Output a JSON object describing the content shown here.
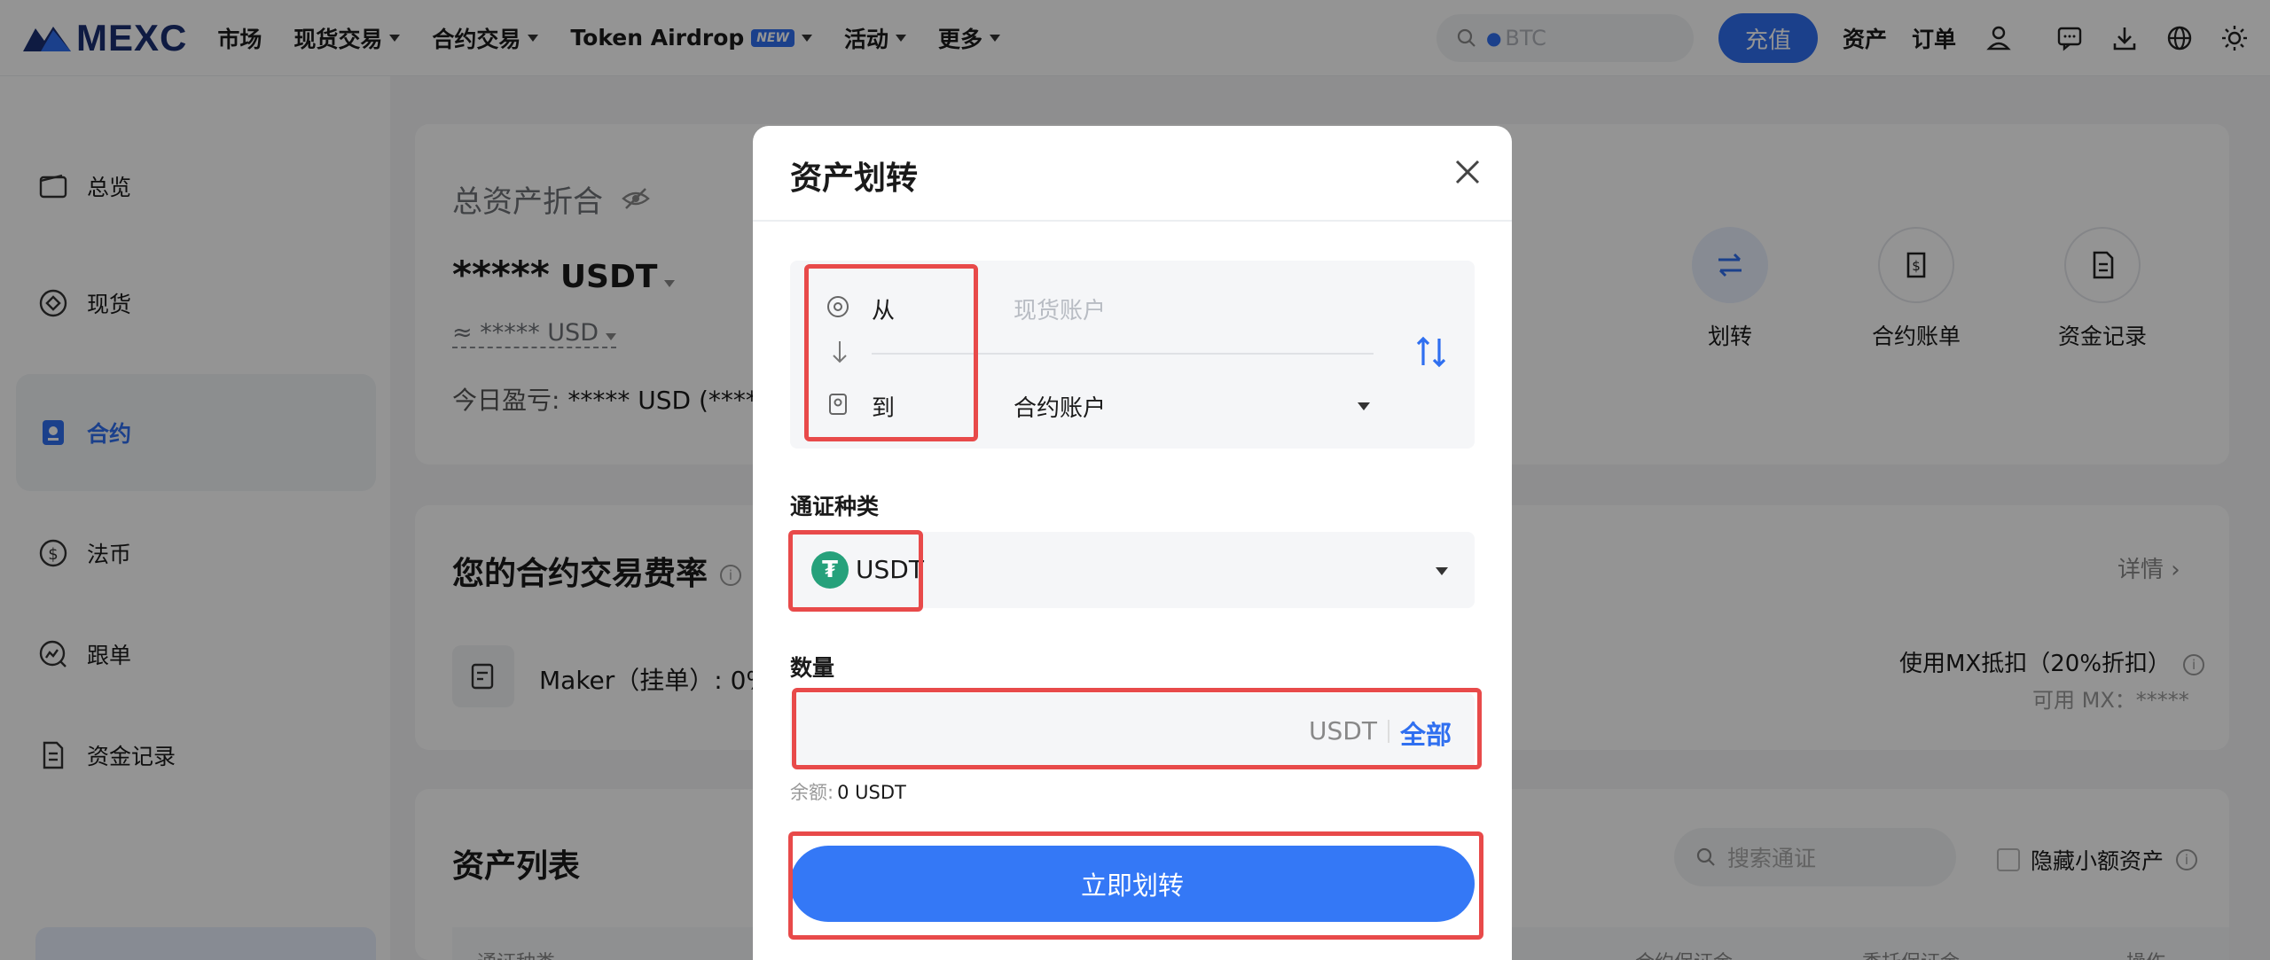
{
  "nav": {
    "logo_text": "MEXC",
    "items": [
      "市场",
      "现货交易",
      "合约交易",
      "Token Airdrop",
      "活动",
      "更多"
    ],
    "airdrop_badge": "NEW",
    "search_placeholder": "BTC",
    "deposit": "充值",
    "assets": "资产",
    "orders": "订单"
  },
  "sidebar": {
    "items": [
      {
        "label": "总览",
        "icon": "wallet-icon"
      },
      {
        "label": "现货",
        "icon": "spot-icon"
      },
      {
        "label": "合约",
        "icon": "futures-icon"
      },
      {
        "label": "法币",
        "icon": "fiat-icon"
      },
      {
        "label": "跟单",
        "icon": "copy-trade-icon"
      },
      {
        "label": "资金记录",
        "icon": "record-icon"
      }
    ],
    "active_index": 2
  },
  "overview": {
    "title": "总资产折合",
    "balance": "*****",
    "balance_unit": "USDT",
    "usd_line": "≈ ***** USD",
    "pnl_label": "今日盈亏:",
    "pnl_value": "***** USD (*****"
  },
  "actions": [
    {
      "label": "划转",
      "icon": "transfer-icon"
    },
    {
      "label": "合约账单",
      "icon": "bill-icon"
    },
    {
      "label": "资金记录",
      "icon": "record-icon"
    }
  ],
  "fees": {
    "title": "您的合约交易费率",
    "details": "详情",
    "maker": "Maker（挂单）: 0%",
    "mx_discount": "使用MX抵扣（20%折扣）",
    "mx_available": "可用 MX：*****"
  },
  "asset_list": {
    "title": "资产列表",
    "search_placeholder": "搜索通证",
    "hide_small": "隐藏小额资产",
    "col_coin": "通证种类",
    "col_margin": "合约保证金",
    "col_order_margin": "委托保证金",
    "col_action": "操作"
  },
  "modal": {
    "title": "资产划转",
    "from_label": "从",
    "from_value": "现货账户",
    "to_label": "到",
    "to_value": "合约账户",
    "coin_label": "通证种类",
    "coin": "USDT",
    "qty_label": "数量",
    "qty_value": "",
    "qty_unit": "USDT",
    "qty_all": "全部",
    "balance_label": "余额:",
    "balance_value": "0 USDT",
    "submit": "立即划转"
  },
  "colors": {
    "accent": "#2f6ff0",
    "highlight": "#e84a4a",
    "tether": "#26a17b"
  }
}
